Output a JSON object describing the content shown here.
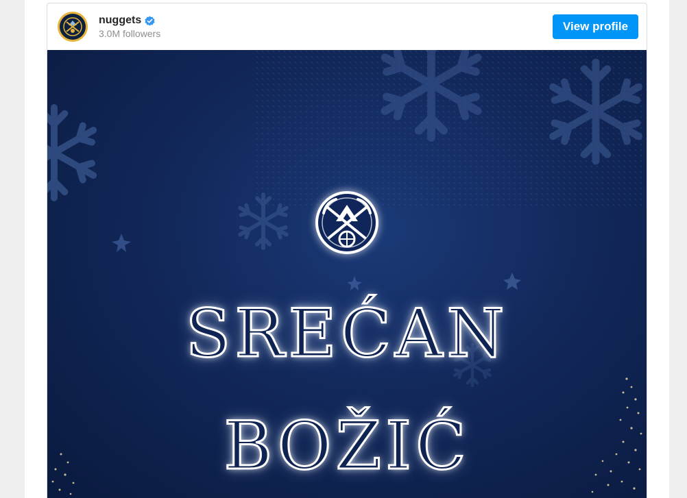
{
  "post": {
    "username": "nuggets",
    "followers": "3.0M followers",
    "view_profile_label": "View profile",
    "image_text": {
      "line1": "SREĆAN",
      "line2": "BOŽIĆ"
    }
  },
  "icons": {
    "verified": "verified-badge-icon",
    "avatar_logo": "nuggets-logo",
    "emblem": "nuggets-pickaxe-logo"
  },
  "colors": {
    "accent": "#0095f6",
    "background_navy": "#12285a",
    "avatar_ring": "#e6b43c"
  }
}
